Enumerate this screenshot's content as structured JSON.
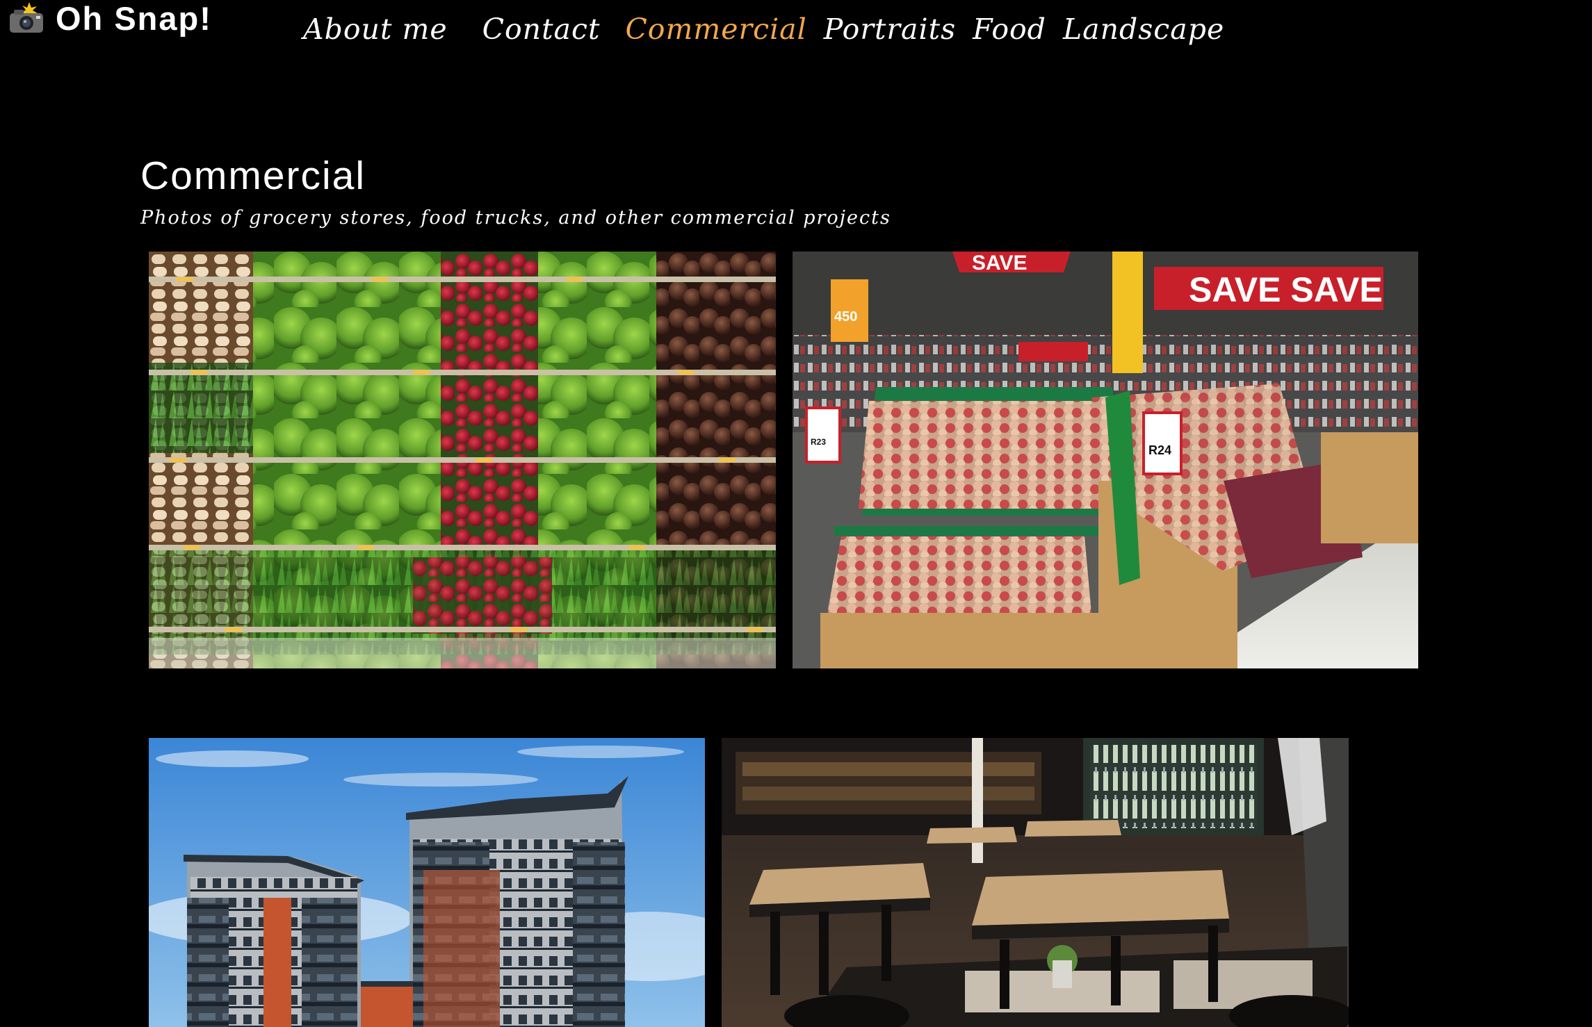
{
  "site": {
    "logo_icon": "camera-flash-icon",
    "logo_text": "Oh Snap!"
  },
  "nav": {
    "items": [
      {
        "label": "About me",
        "active": false
      },
      {
        "label": "Contact",
        "active": false
      },
      {
        "label": "Commercial",
        "active": true
      },
      {
        "label": "Portraits",
        "active": false
      },
      {
        "label": "Food",
        "active": false
      },
      {
        "label": "Landscape",
        "active": false
      }
    ],
    "active_color": "#f4a74a"
  },
  "page": {
    "title": "Commercial",
    "subtitle": "Photos of grocery stores, food trucks, and other commercial projects"
  },
  "gallery": {
    "photo_signs": {
      "save_sign": "SAVE",
      "save_banner": "SAVE SAVE",
      "price_a": "R23",
      "price_b": "R24",
      "price_c": "450"
    }
  }
}
